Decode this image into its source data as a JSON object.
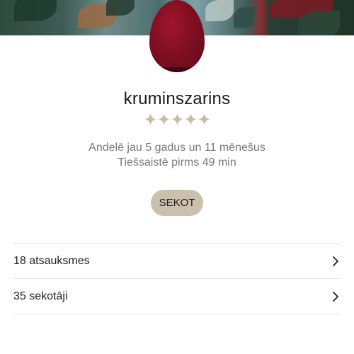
{
  "profile": {
    "username": "kruminszarins",
    "rating_stars": 5,
    "member_since": "Andelē jau 5 gadus un 11 mēnešus",
    "last_online": "Tiešsaistē pirms 49 min",
    "follow_label": "SEKOT"
  },
  "stats": [
    {
      "label": "18 atsauksmes",
      "icon": "chevron-right-icon"
    },
    {
      "label": "35 sekotāji",
      "icon": "chevron-right-icon"
    }
  ],
  "colors": {
    "star": "#c9bca6",
    "follow_button": "#cbbfad",
    "avatar": "#8a1024",
    "secondary_text": "#7a7a7a"
  }
}
